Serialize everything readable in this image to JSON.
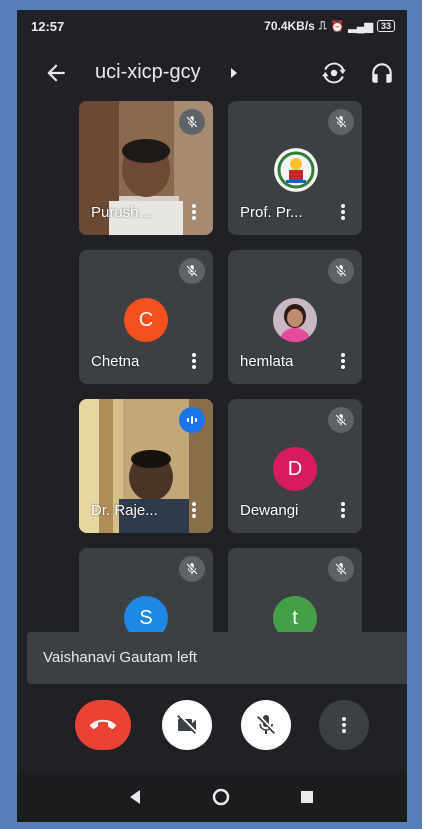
{
  "status_bar": {
    "time": "12:57",
    "speed": "70.4KB/s",
    "battery": "33"
  },
  "top_bar": {
    "meeting_code": "uci-xicp-gcy"
  },
  "participants": [
    {
      "name": "Purush...",
      "type": "video",
      "muted": true
    },
    {
      "name": "Prof. Pr...",
      "type": "logo",
      "muted": true
    },
    {
      "name": "Chetna",
      "type": "letter",
      "letter": "C",
      "color": "#f4511e",
      "muted": true
    },
    {
      "name": "hemlata",
      "type": "photo",
      "muted": true
    },
    {
      "name": "Dr. Raje...",
      "type": "video",
      "speaking": true
    },
    {
      "name": "Dewangi",
      "type": "letter",
      "letter": "D",
      "color": "#d81b60",
      "muted": true
    },
    {
      "name": "",
      "type": "letter",
      "letter": "S",
      "color": "#1e88e5",
      "muted": true
    },
    {
      "name": "",
      "type": "letter",
      "letter": "t",
      "color": "#43a047",
      "muted": true
    }
  ],
  "toast": {
    "text": "Vaishanavi Gautam left"
  },
  "controls": {
    "end_call_color": "#ea4335"
  },
  "icons": [
    "back-arrow-icon",
    "caret-right-icon",
    "switch-camera-icon",
    "headphones-icon",
    "mic-off-icon",
    "more-vert-icon",
    "speaking-icon",
    "phone-hangup-icon",
    "videocam-off-icon",
    "nav-back-icon",
    "nav-home-icon",
    "nav-recents-icon"
  ]
}
